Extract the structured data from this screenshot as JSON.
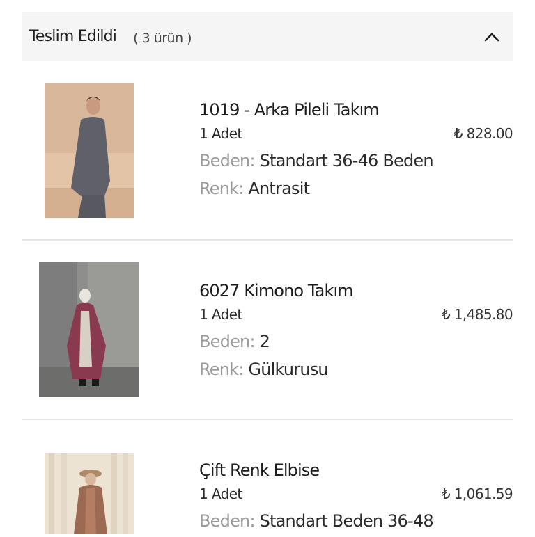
{
  "section": {
    "title": "Teslim Edildi",
    "count": "( 3 ürün )"
  },
  "products": [
    {
      "name": "1019 - Arka Pileli Takım",
      "qty": "1 Adet",
      "price": "₺ 828.00",
      "size_label": "Beden:",
      "size_value": "Standart 36-46 Beden",
      "color_label": "Renk:",
      "color_value": "Antrasit",
      "image_icon": "product-photo-grey-set"
    },
    {
      "name": "6027 Kimono Takım",
      "qty": "1 Adet",
      "price": "₺ 1,485.80",
      "size_label": "Beden:",
      "size_value": "2",
      "color_label": "Renk:",
      "color_value": "Gülkurusu",
      "image_icon": "product-photo-kimono"
    },
    {
      "name": "Çift Renk Elbise",
      "qty": "1 Adet",
      "price": "₺ 1,061.59",
      "size_label": "Beden:",
      "size_value": "Standart Beden 36-48",
      "image_icon": "product-photo-dress"
    }
  ],
  "colors": {
    "header_bg": "#f5f5f5",
    "label_grey": "#9a9a9a",
    "divider": "#e5e5e5"
  }
}
